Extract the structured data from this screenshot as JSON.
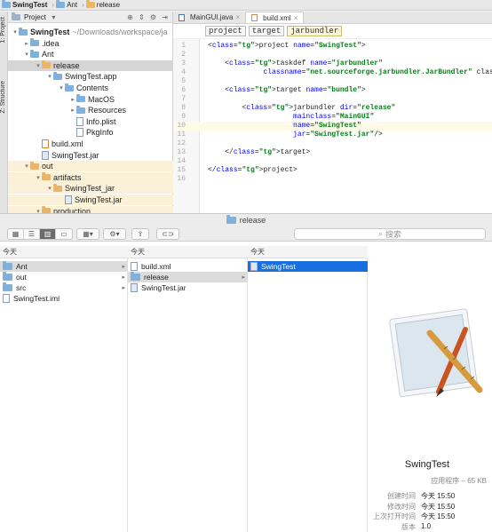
{
  "ide": {
    "breadcrumb": [
      "SwingTest",
      "Ant",
      "release"
    ],
    "side_tabs": [
      "1: Project",
      "Z: Structure"
    ],
    "project_panel": {
      "header": "Project",
      "tree": [
        {
          "label": "SwingTest",
          "extra": "~/Downloads/workspace/ja",
          "depth": 0,
          "open": true,
          "icon": "folder",
          "bold": true
        },
        {
          "label": ".idea",
          "depth": 1,
          "open": false,
          "icon": "folder"
        },
        {
          "label": "Ant",
          "depth": 1,
          "open": true,
          "icon": "folder"
        },
        {
          "label": "release",
          "depth": 2,
          "open": true,
          "icon": "folder-orange",
          "selected": true
        },
        {
          "label": "SwingTest.app",
          "depth": 3,
          "open": true,
          "icon": "folder"
        },
        {
          "label": "Contents",
          "depth": 4,
          "open": true,
          "icon": "folder"
        },
        {
          "label": "MacOS",
          "depth": 5,
          "open": false,
          "icon": "folder"
        },
        {
          "label": "Resources",
          "depth": 5,
          "open": false,
          "icon": "folder"
        },
        {
          "label": "Info.plist",
          "depth": 5,
          "icon": "file"
        },
        {
          "label": "PkgInfo",
          "depth": 5,
          "icon": "file"
        },
        {
          "label": "build.xml",
          "depth": 2,
          "icon": "file-xml"
        },
        {
          "label": "SwingTest.jar",
          "depth": 2,
          "icon": "file-jar"
        },
        {
          "label": "out",
          "depth": 1,
          "open": true,
          "icon": "folder-orange",
          "highlight": true
        },
        {
          "label": "artifacts",
          "depth": 2,
          "open": true,
          "icon": "folder-orange",
          "highlight": true
        },
        {
          "label": "SwingTest_jar",
          "depth": 3,
          "open": true,
          "icon": "folder-orange",
          "highlight": true
        },
        {
          "label": "SwingTest.jar",
          "depth": 4,
          "icon": "file-jar",
          "highlight": true
        },
        {
          "label": "production",
          "depth": 2,
          "open": true,
          "icon": "folder-orange",
          "highlight": true
        }
      ]
    },
    "editor": {
      "tabs": [
        {
          "label": "MainGUI.java",
          "active": false
        },
        {
          "label": "build.xml",
          "active": true
        }
      ],
      "tags": [
        "project",
        "target",
        "jarbundler"
      ],
      "current_line": 10,
      "lines": [
        {
          "n": "1",
          "code": "<project name=\"SwingTest\">"
        },
        {
          "n": "2",
          "code": ""
        },
        {
          "n": "3",
          "code": "    <taskdef name=\"jarbundler\""
        },
        {
          "n": "4",
          "code": "             classname=\"net.sourceforge.jarbundler.JarBundler\" classpa"
        },
        {
          "n": "5",
          "code": ""
        },
        {
          "n": "6",
          "code": "    <target name=\"bundle\">"
        },
        {
          "n": "7",
          "code": ""
        },
        {
          "n": "8",
          "code": "        <jarbundler dir=\"release\""
        },
        {
          "n": "9",
          "code": "                    mainclass=\"MainGUI\""
        },
        {
          "n": "10",
          "code": "                    name=\"SwingTest\""
        },
        {
          "n": "11",
          "code": "                    jar=\"SwingTest.jar\"/>"
        },
        {
          "n": "12",
          "code": ""
        },
        {
          "n": "13",
          "code": "    </target>"
        },
        {
          "n": "14",
          "code": ""
        },
        {
          "n": "15",
          "code": "</project>"
        },
        {
          "n": "16",
          "code": ""
        }
      ]
    }
  },
  "finder": {
    "title": "release",
    "search_placeholder": "搜索",
    "columns": [
      {
        "header": "今天",
        "items": [
          {
            "label": "Ant",
            "type": "folder",
            "has_children": true,
            "state": "grey"
          },
          {
            "label": "out",
            "type": "folder",
            "has_children": true
          },
          {
            "label": "src",
            "type": "folder",
            "has_children": true
          },
          {
            "label": "SwingTest.iml",
            "type": "file"
          }
        ]
      },
      {
        "header": "今天",
        "items": [
          {
            "label": "build.xml",
            "type": "file"
          },
          {
            "label": "release",
            "type": "folder",
            "has_children": true,
            "state": "grey"
          },
          {
            "label": "SwingTest.jar",
            "type": "file-jar"
          }
        ]
      },
      {
        "header": "今天",
        "items": [
          {
            "label": "SwingTest",
            "type": "app",
            "state": "blue"
          }
        ]
      }
    ],
    "preview": {
      "name": "SwingTest",
      "kind_size": "应用程序 – 65 KB",
      "meta": [
        {
          "k": "创建时间",
          "v": "今天 15:50"
        },
        {
          "k": "修改时间",
          "v": "今天 15:50"
        },
        {
          "k": "上次打开时间",
          "v": "今天 15:50"
        },
        {
          "k": "版本",
          "v": "1.0"
        }
      ]
    }
  }
}
